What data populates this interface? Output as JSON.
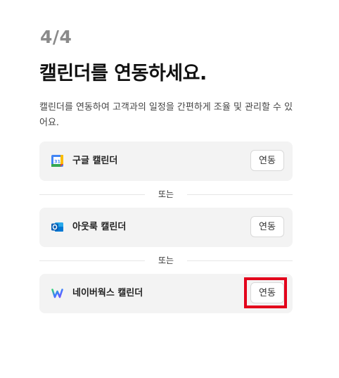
{
  "header": {
    "step": "4/4",
    "title": "캘린더를 연동하세요.",
    "description": "캘린더를 연동하여 고객과의 일정을 간편하게 조율 및 관리할 수 있어요."
  },
  "calendars": [
    {
      "name": "구글 캘린더",
      "icon": "google-calendar-icon",
      "button": "연동"
    },
    {
      "name": "아웃룩 캘린더",
      "icon": "outlook-icon",
      "button": "연동"
    },
    {
      "name": "네이버웍스 캘린더",
      "icon": "naver-works-icon",
      "button": "연동"
    }
  ],
  "dividers": [
    "또는",
    "또는"
  ],
  "colors": {
    "card_bg": "#f3f3f3",
    "highlight": "#e3001b",
    "step": "#8a8a8a"
  }
}
